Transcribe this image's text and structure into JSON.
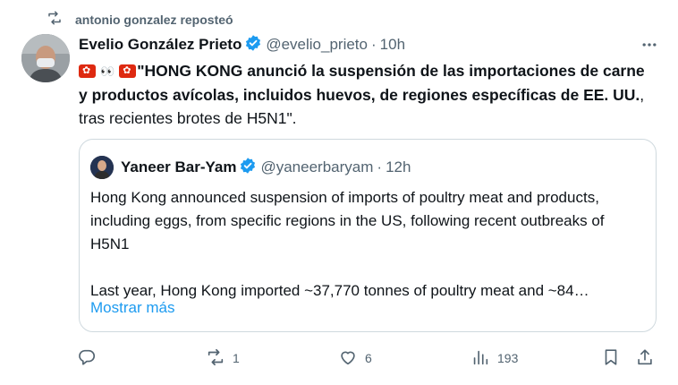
{
  "repost": {
    "label": "antonio gonzalez reposteó",
    "icon": "repost-icon"
  },
  "tweet": {
    "author_name": "Evelio González Prieto",
    "handle": "@evelio_prieto",
    "separator": "·",
    "time": "10h",
    "text_quote_open": "\"",
    "text_bold": "HONG KONG anunció la suspensión de las importaciones de carne y productos avícolas, incluidos huevos, de regiones específicas de EE. UU.",
    "text_rest": ", tras recientes brotes de H5N1\".",
    "emoji": [
      "hong-kong-flag",
      "eyes",
      "hong-kong-flag"
    ],
    "more_icon": "more-icon"
  },
  "quote": {
    "author_name": "Yaneer Bar-Yam",
    "handle": "@yaneerbaryam",
    "separator": "·",
    "time": "12h",
    "paragraph1": "Hong Kong announced suspension of imports of poultry meat and products, including eggs, from specific regions in the US, following recent outbreaks of H5N1",
    "paragraph2": "Last year, Hong Kong imported ~37,770 tonnes of poultry meat and ~84…",
    "show_more": "Mostrar más"
  },
  "actions": {
    "reply": {
      "icon": "reply-icon",
      "count": ""
    },
    "repost": {
      "icon": "repost-icon",
      "count": "1"
    },
    "like": {
      "icon": "heart-icon",
      "count": "6"
    },
    "views": {
      "icon": "views-icon",
      "count": "193"
    },
    "bookmark": {
      "icon": "bookmark-icon"
    },
    "share": {
      "icon": "share-icon"
    }
  },
  "colors": {
    "accent": "#1d9bf0",
    "muted": "#536471",
    "border": "#cfd9de",
    "flag_red": "#de2910"
  }
}
